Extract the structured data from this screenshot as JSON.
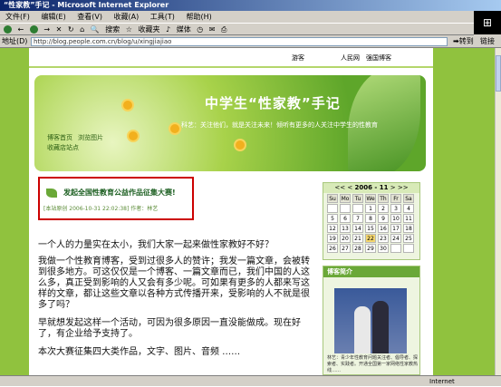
{
  "window": {
    "title": "“性家教”手记 - Microsoft Internet Explorer"
  },
  "menu": [
    "文件(F)",
    "编辑(E)",
    "查看(V)",
    "收藏(A)",
    "工具(T)",
    "帮助(H)"
  ],
  "toolbar": {
    "back_label": "←",
    "forward_label": "→",
    "search_label": "搜索",
    "favorites_label": "收藏夹",
    "media_label": "媒体"
  },
  "address": {
    "label": "地址(D)",
    "value": "http://blog.people.com.cn/blog/u/xingjiajiao",
    "go_label": "转到",
    "links_label": "链接"
  },
  "status": {
    "zone": "Internet"
  },
  "site": {
    "nav": [
      "游客",
      "人民网",
      "强国博客"
    ],
    "banner_title": "中学生“性家教”手记",
    "banner_slogan": "科艺：关注他们，就是关注未来！倾听有更多的人关注中学生的性教育",
    "tabs": [
      "博客首页",
      "浏览图片",
      "收藏店站点"
    ]
  },
  "article": {
    "title": "发起全国性教育公益作品征集大赛!",
    "meta": "[本站原创 2006-10-31 22:02:38] 作者：林艺",
    "paragraphs": [
      "一个人的力量实在太小，我们大家一起来做性家教好不好？",
      "我做一个性教育博客，受到过很多人的赞许；我发一篇文章，会被转到很多地方。可这仅仅是一个博客、一篇文章而已，我们中国的人这么多，真正受到影响的人又会有多少呢。可如果有更多的人都来写这样的文章，都让这些文章以各种方式传播开来，受影响的人不就是很多了吗？",
      "早就想发起这样一个活动，可因为很多原因一直没能做成。现在好了，有企业给予支持了。",
      "本次大赛征集四大类作品，文字、图片、音频 ……"
    ]
  },
  "calendar": {
    "prev_label": "<<",
    "prev_single": "<",
    "month_label": "2006 - 11",
    "next_single": ">",
    "next_label": ">>",
    "weekdays": [
      "Su",
      "Mo",
      "Tu",
      "We",
      "Th",
      "Fr",
      "Sa"
    ],
    "weeks": [
      [
        "",
        "",
        "",
        "1",
        "2",
        "3",
        "4"
      ],
      [
        "5",
        "6",
        "7",
        "8",
        "9",
        "10",
        "11"
      ],
      [
        "12",
        "13",
        "14",
        "15",
        "16",
        "17",
        "18"
      ],
      [
        "19",
        "20",
        "21",
        "22",
        "23",
        "24",
        "25"
      ],
      [
        "26",
        "27",
        "28",
        "29",
        "30",
        "",
        ""
      ]
    ],
    "today": "22"
  },
  "profile": {
    "heading": "博客简介",
    "text": "林艺：青少年性教育问题关注者、倡导者、探索者、实践者。开通全国第一家网络性家教热线……"
  },
  "colors": {
    "page_bg": "#90c23e",
    "accent_green": "#6aa838",
    "highlight_red": "#cc0000",
    "title_bar": "#0a246a"
  }
}
